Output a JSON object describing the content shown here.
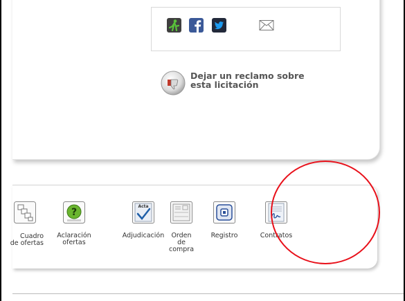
{
  "reclamo": {
    "label": "Dejar un reclamo sobre\nesta licitación"
  },
  "share": {
    "icons": [
      "person-share-icon",
      "facebook-icon",
      "twitter-icon",
      "email-icon"
    ]
  },
  "toolbar": {
    "items": [
      {
        "label": "Cuadro\nde ofertas",
        "icon": "cuadro-ofertas-icon"
      },
      {
        "label": "Aclaración\nofertas",
        "icon": "help-question-icon"
      },
      {
        "label": "Adjudicación",
        "icon": "acta-checkmark-icon",
        "badge": "Acta"
      },
      {
        "label": "Orden de\ncompra",
        "icon": "purchase-order-icon"
      },
      {
        "label": "Registro",
        "icon": "registro-icon"
      },
      {
        "label": "Contratos",
        "icon": "contract-signature-icon"
      }
    ]
  },
  "colors": {
    "annotation": "#e8101a",
    "facebook": "#3b5998",
    "twitter": "#1d9bf0",
    "help": "#6ab52f",
    "person_share": "#4a9a2a"
  }
}
